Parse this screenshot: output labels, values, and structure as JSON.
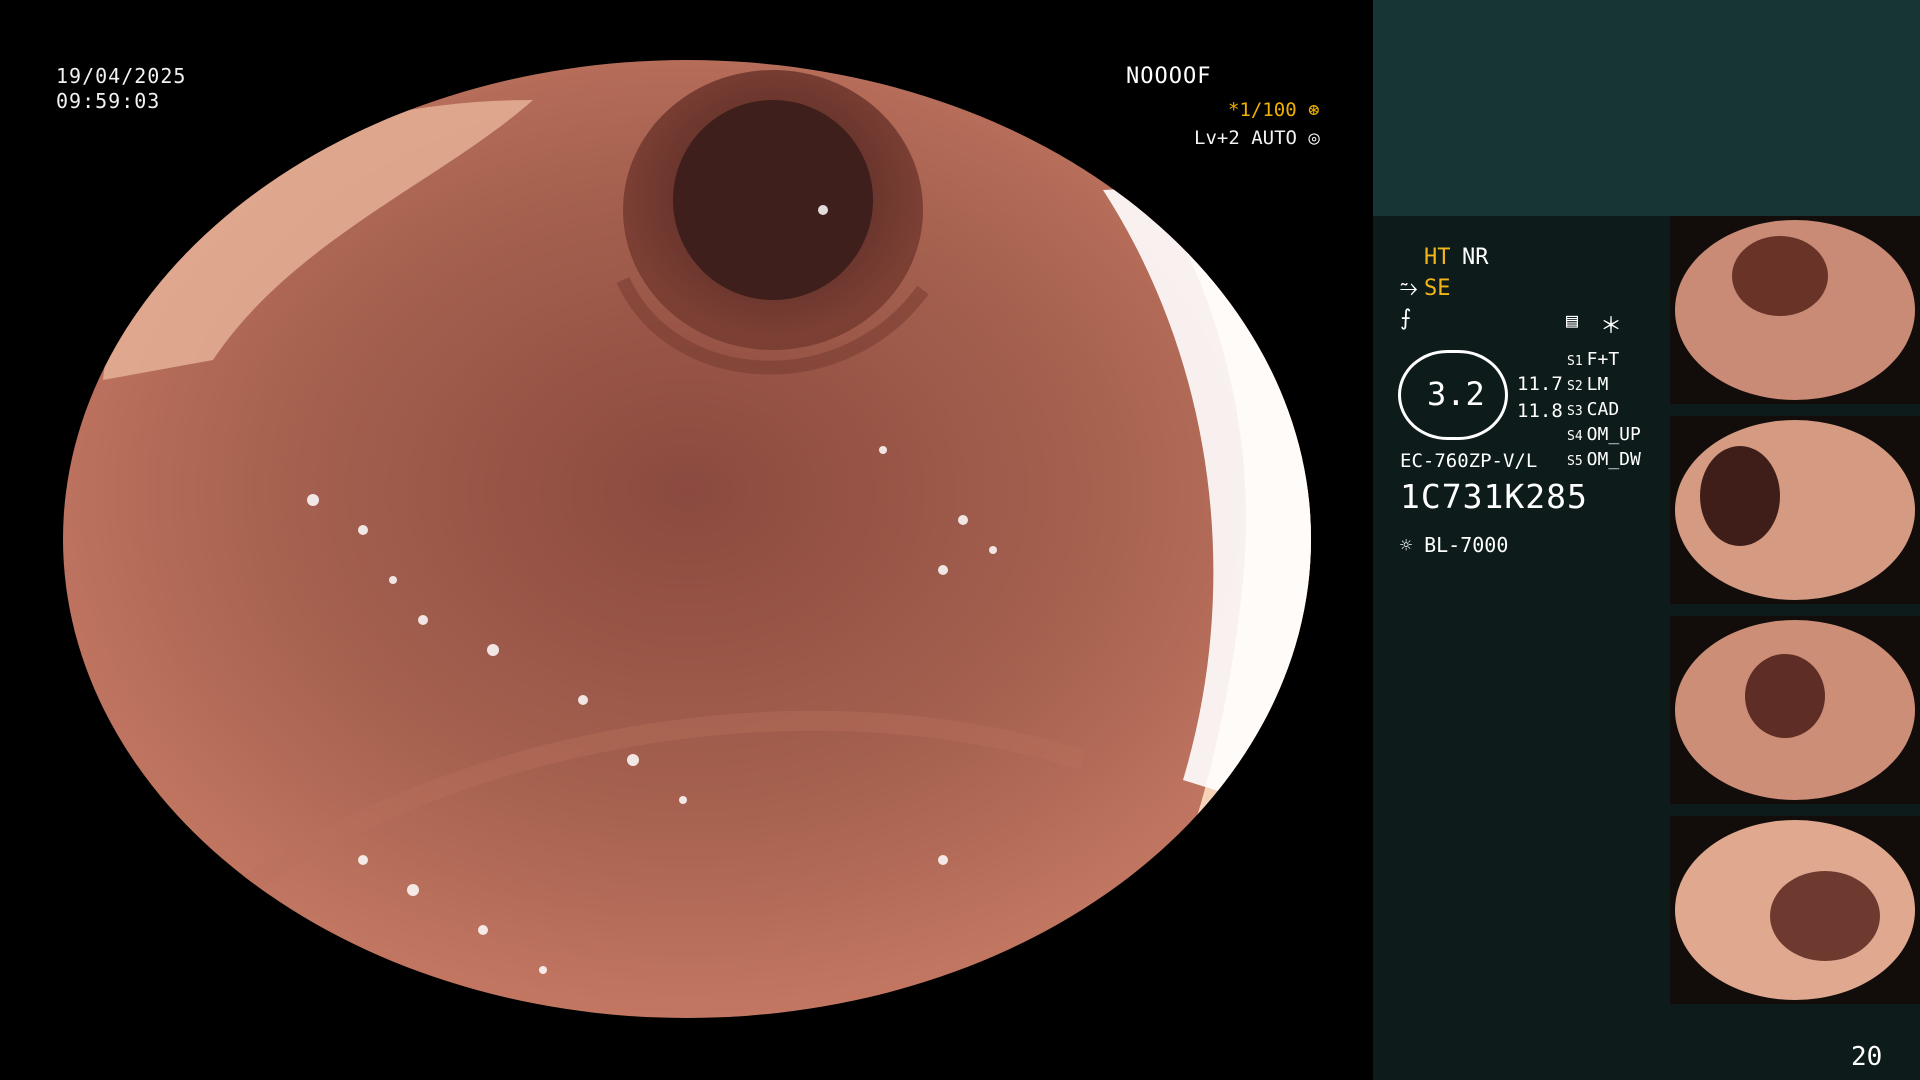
{
  "overlay": {
    "date": "19/04/2025",
    "time": "09:59:03",
    "code": "NOOOOF",
    "shutter": "*1/100",
    "level": "Lv+2 AUTO"
  },
  "panel": {
    "ht": "HT",
    "nr": "NR",
    "se": "SE",
    "badge_value": "3.2",
    "values": [
      "11.7",
      "11.8"
    ],
    "s_labels": [
      "S1",
      "S2",
      "S3",
      "S4",
      "S5"
    ],
    "s_values": [
      "F+T",
      "LM",
      "CAD",
      "OM_UP",
      "OM_DW"
    ],
    "model": "EC-760ZP-V/L",
    "serial": "1C731K285",
    "lamp": "BL-7000",
    "page_number": "20"
  },
  "colors": {
    "panel_bg": "#0e1b1b",
    "panel_top": "#173535",
    "accent": "#f3b619"
  },
  "icons": [
    "star-icon",
    "lamp-icon",
    "menu-icon",
    "diaphragm-icon"
  ]
}
